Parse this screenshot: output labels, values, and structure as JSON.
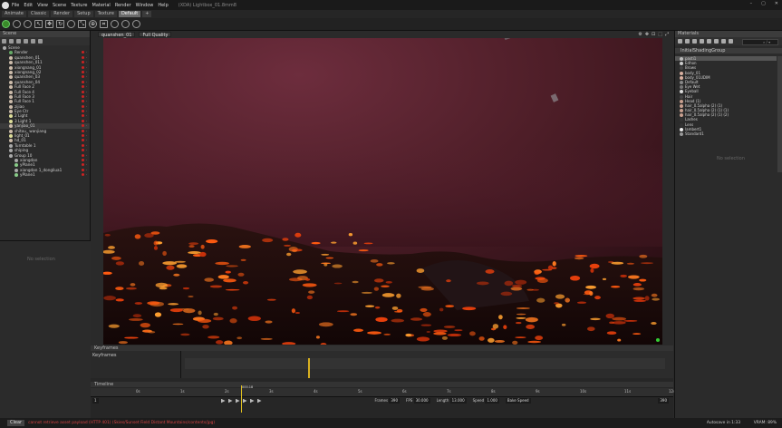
{
  "window": {
    "title": "(XDA) Lightbox_01.8mm8",
    "menu": [
      "File",
      "Edit",
      "View",
      "Scene",
      "Texture",
      "Material",
      "Render",
      "Window",
      "Help"
    ],
    "controls": [
      "–",
      "▢",
      "✕"
    ]
  },
  "layout_tabs": [
    "Animate",
    "Classic",
    "Render",
    "Setup",
    "Texture",
    "Default",
    "+"
  ],
  "scene": {
    "header": "Scene",
    "items": [
      {
        "label": "Scene",
        "color": "#aaa"
      },
      {
        "label": "Render",
        "color": "#6a6"
      },
      {
        "label": "quanshen_01",
        "color": "#cba"
      },
      {
        "label": "quanshen_011",
        "color": "#cba"
      },
      {
        "label": "xiongnang_01",
        "color": "#cba"
      },
      {
        "label": "xiongnang_02",
        "color": "#cba"
      },
      {
        "label": "quanshen_03",
        "color": "#cba"
      },
      {
        "label": "quanshen_04",
        "color": "#cba"
      },
      {
        "label": "Full Face 2",
        "color": "#cba"
      },
      {
        "label": "Full Face 4",
        "color": "#cba"
      },
      {
        "label": "Full Face 3",
        "color": "#cba"
      },
      {
        "label": "Full Face 1",
        "color": "#cba"
      },
      {
        "label": "zijiao",
        "color": "#cba"
      },
      {
        "label": "Eye Ctr",
        "color": "#cba"
      },
      {
        "label": "2 Light",
        "color": "#dd9"
      },
      {
        "label": "3 Light 1",
        "color": "#dd9"
      },
      {
        "label": "yanjiao_01",
        "color": "#cba",
        "sel": true
      },
      {
        "label": "shitou_ wanjiang",
        "color": "#cba"
      },
      {
        "label": "light_01",
        "color": "#dd9"
      },
      {
        "label": "hd_01",
        "color": "#cba"
      },
      {
        "label": "Turntable 1",
        "color": "#aaa"
      },
      {
        "label": "shiping",
        "color": "#aaa"
      },
      {
        "label": "Group 10",
        "color": "#aaa"
      },
      {
        "label": "xiangdan",
        "color": "#aaa"
      },
      {
        "label": "yPlane1",
        "color": "#8c8"
      },
      {
        "label": "xiangdan 1_dongliua1",
        "color": "#aaa"
      },
      {
        "label": "yPlane1",
        "color": "#8c8"
      }
    ],
    "empty": "No selection"
  },
  "viewport": {
    "camera": "quanshen_01",
    "quality": "Full Quality",
    "icons": [
      "⚙",
      "✥",
      "⊡",
      "⬚",
      "⤢"
    ]
  },
  "keyframes": {
    "header": "Keyframes",
    "row_label": "Keyframes"
  },
  "timeline": {
    "header": "Timeline",
    "ticks": [
      "0s",
      "1s",
      "2s",
      "3s",
      "4s",
      "5s",
      "6s",
      "7s",
      "8s",
      "9s",
      "10s",
      "11s",
      "12s"
    ],
    "cursor_label": "000.18",
    "start": "1",
    "frames_label": "Frames",
    "frames_value": "390",
    "fps_label": "FPS",
    "fps_value": "30.000",
    "length_label": "Length",
    "length_value": "13.000",
    "speed_label": "Speed",
    "speed_value": "1.000",
    "bake_label": "Bake Speed",
    "end_frame": "390"
  },
  "materials": {
    "header": "Materials",
    "group": "InitialShadingGroup",
    "search_placeholder": "⌕ / ▾",
    "empty": "No selection",
    "items": [
      {
        "label": "pasti1",
        "color": "#bbb",
        "sel": true
      },
      {
        "label": "Edhon",
        "color": "#ccc"
      },
      {
        "label": "Brows",
        "color": "#444"
      },
      {
        "label": "body_01",
        "color": "#d8b0a0"
      },
      {
        "label": "body_01UDIM",
        "color": "#d8b0a0"
      },
      {
        "label": "Default",
        "color": "#888"
      },
      {
        "label": "Eye Wet",
        "color": "#777"
      },
      {
        "label": "Eyeball",
        "color": "#ddd"
      },
      {
        "label": "Hair",
        "color": "#444"
      },
      {
        "label": "Head (1)",
        "color": "#c9a090"
      },
      {
        "label": "hair_0.5alpha (2) (1)",
        "color": "#c9a090"
      },
      {
        "label": "hair_0.5alpha (2) (1) (1)",
        "color": "#c9a090"
      },
      {
        "label": "hair_0.5alpha (2) (1) (2)",
        "color": "#c9a090"
      },
      {
        "label": "Lashes",
        "color": "#333"
      },
      {
        "label": "Lens",
        "color": "#333"
      },
      {
        "label": "lambert1",
        "color": "#eee"
      },
      {
        "label": "Standard1",
        "color": "#999"
      }
    ]
  },
  "status": {
    "button": "Clear",
    "message": "cannot retrieve asset payload (HTTP 401) (Skies/Sunset Field Distant Mountains/contents/jpg)",
    "autosave": "Autosave in 1:33",
    "vram": "VRAM: 89%"
  }
}
